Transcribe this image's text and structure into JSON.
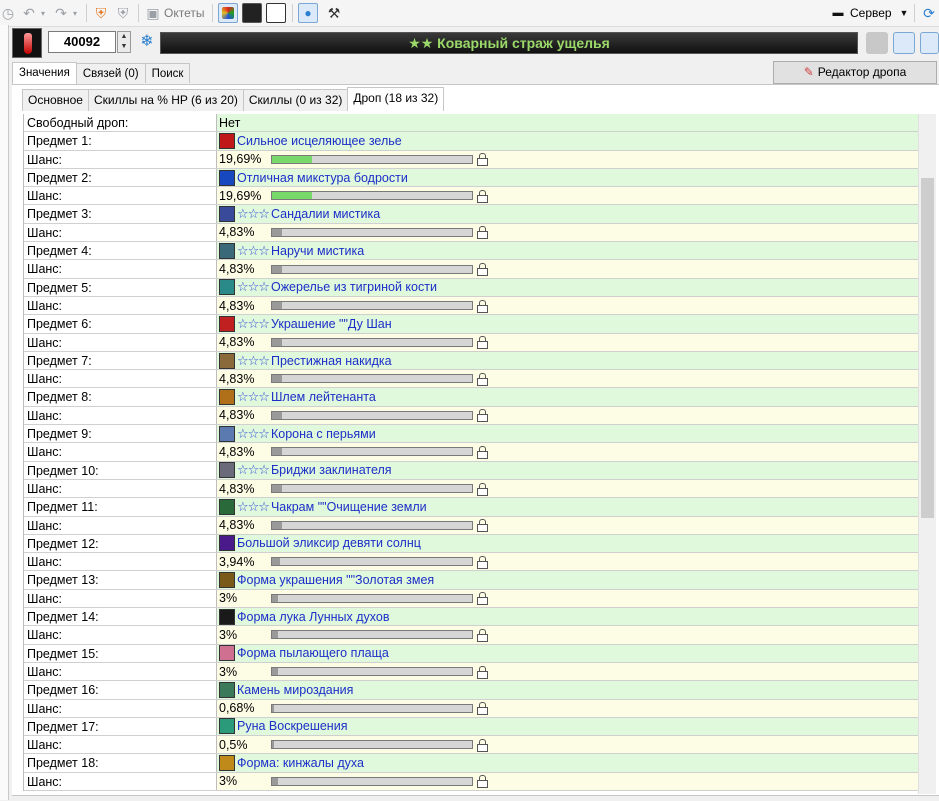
{
  "toolbar": {
    "octets_label": "Октеты",
    "server_label": "Сервер"
  },
  "header": {
    "item_id": "40092",
    "title": "★★ Коварный страж ущелья"
  },
  "tabs_main": [
    {
      "label": "Значения",
      "active": true
    },
    {
      "label": "Связей (0)",
      "active": false
    },
    {
      "label": "Поиск",
      "active": false
    }
  ],
  "drop_editor_label": "Редактор дропа",
  "tabs_sub": [
    {
      "label": "Основное",
      "active": false
    },
    {
      "label": "Скиллы на % HP (6 из 20)",
      "active": false
    },
    {
      "label": "Скиллы (0 из 32)",
      "active": false
    },
    {
      "label": "Дроп (18 из 32)",
      "active": true
    }
  ],
  "chance_label": "Шанс:",
  "free_drop": {
    "label": "Свободный дроп:",
    "value": "Нет"
  },
  "items": [
    {
      "label": "Предмет 1:",
      "name": "Сильное исцеляющее зелье",
      "stars": "",
      "chance": "19,69%",
      "fraction": 0.1969,
      "icon_color": "#c01818"
    },
    {
      "label": "Предмет 2:",
      "name": "Отличная микстура бодрости",
      "stars": "",
      "chance": "19,69%",
      "fraction": 0.1969,
      "icon_color": "#1848c0"
    },
    {
      "label": "Предмет 3:",
      "name": "Сандалии мистика",
      "stars": "☆☆☆",
      "chance": "4,83%",
      "fraction": 0.0483,
      "icon_color": "#3a4a9a"
    },
    {
      "label": "Предмет 4:",
      "name": "Наручи мистика",
      "stars": "☆☆☆",
      "chance": "4,83%",
      "fraction": 0.0483,
      "icon_color": "#3a6a7a"
    },
    {
      "label": "Предмет 5:",
      "name": "Ожерелье из тигриной кости",
      "stars": "☆☆☆",
      "chance": "4,83%",
      "fraction": 0.0483,
      "icon_color": "#2a8a8a"
    },
    {
      "label": "Предмет 6:",
      "name": "Украшение \"\"Ду Шан",
      "stars": "☆☆☆",
      "chance": "4,83%",
      "fraction": 0.0483,
      "icon_color": "#c02020"
    },
    {
      "label": "Предмет 7:",
      "name": "Престижная накидка",
      "stars": "☆☆☆",
      "chance": "4,83%",
      "fraction": 0.0483,
      "icon_color": "#8a6a3a"
    },
    {
      "label": "Предмет 8:",
      "name": "Шлем лейтенанта",
      "stars": "☆☆☆",
      "chance": "4,83%",
      "fraction": 0.0483,
      "icon_color": "#b0701a"
    },
    {
      "label": "Предмет 9:",
      "name": "Корона с перьями",
      "stars": "☆☆☆",
      "chance": "4,83%",
      "fraction": 0.0483,
      "icon_color": "#5a7ab0"
    },
    {
      "label": "Предмет 10:",
      "name": "Бриджи заклинателя",
      "stars": "☆☆☆",
      "chance": "4,83%",
      "fraction": 0.0483,
      "icon_color": "#6a6a7a"
    },
    {
      "label": "Предмет 11:",
      "name": "Чакрам \"\"Очищение земли",
      "stars": "☆☆☆",
      "chance": "4,83%",
      "fraction": 0.0483,
      "icon_color": "#2a6a3a"
    },
    {
      "label": "Предмет 12:",
      "name": "Большой эликсир девяти солнц",
      "stars": "",
      "chance": "3,94%",
      "fraction": 0.0394,
      "icon_color": "#4a1a8a"
    },
    {
      "label": "Предмет 13:",
      "name": "Форма украшения \"\"Золотая змея",
      "stars": "",
      "chance": "3%",
      "fraction": 0.03,
      "icon_color": "#7a5a1a"
    },
    {
      "label": "Предмет 14:",
      "name": "Форма лука Лунных духов",
      "stars": "",
      "chance": "3%",
      "fraction": 0.03,
      "icon_color": "#1a1a1a"
    },
    {
      "label": "Предмет 15:",
      "name": "Форма пылающего плаща",
      "stars": "",
      "chance": "3%",
      "fraction": 0.03,
      "icon_color": "#d07090"
    },
    {
      "label": "Предмет 16:",
      "name": "Камень мироздания",
      "stars": "",
      "chance": "0,68%",
      "fraction": 0.0068,
      "icon_color": "#3a7a5a"
    },
    {
      "label": "Предмет 17:",
      "name": "Руна Воскрешения",
      "stars": "",
      "chance": "0,5%",
      "fraction": 0.005,
      "icon_color": "#2a9a7a"
    },
    {
      "label": "Предмет 18:",
      "name": "Форма: кинжалы духа",
      "stars": "",
      "chance": "3%",
      "fraction": 0.03,
      "icon_color": "#c08a1a"
    }
  ]
}
